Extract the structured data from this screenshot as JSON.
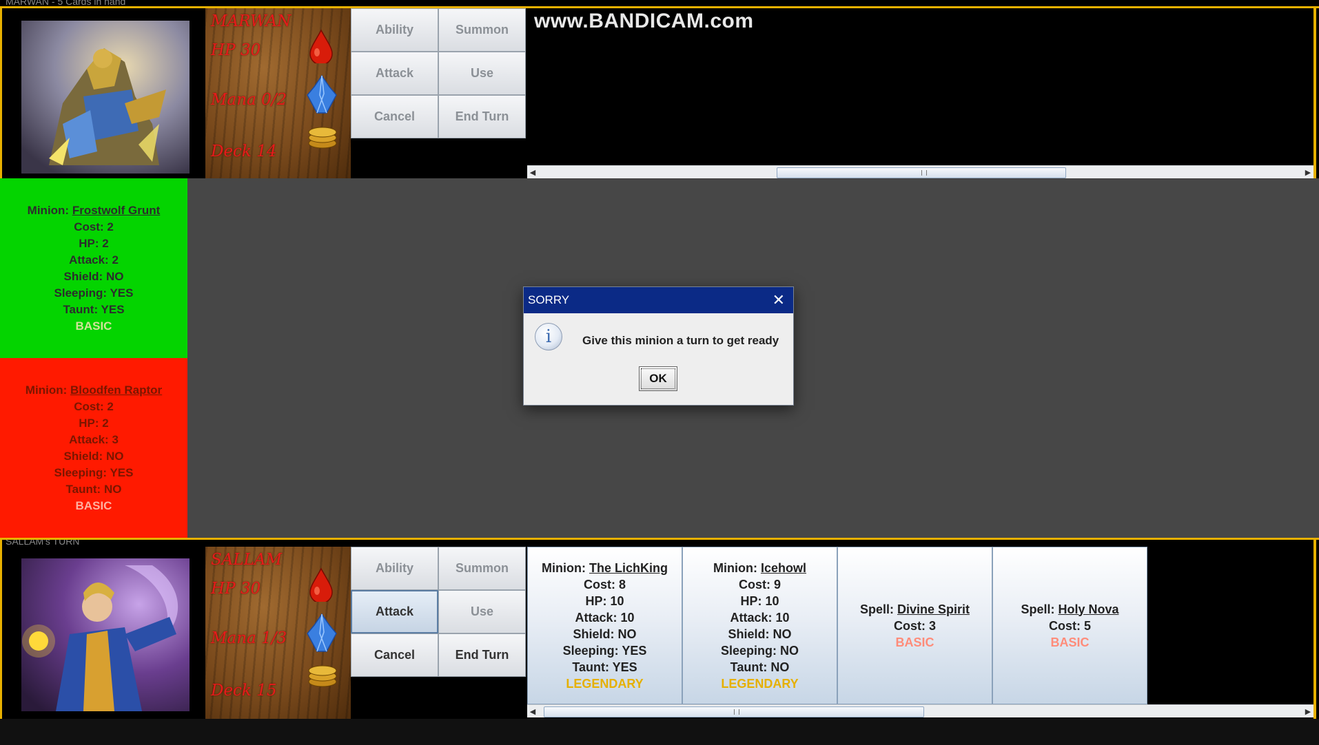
{
  "watermark": "www.BANDICAM.com",
  "top_strip": "MARWAN - 5 Cards in hand",
  "bottom_strip": "SALLAM's TURN",
  "opponent": {
    "name": "MARWAN",
    "hp": "HP 30",
    "mana": "Mana 0/2",
    "deck": "Deck 14",
    "buttons": {
      "ability": "Ability",
      "summon": "Summon",
      "attack": "Attack",
      "use": "Use",
      "cancel": "Cancel",
      "end_turn": "End Turn"
    }
  },
  "player": {
    "name": "SALLAM",
    "hp": "HP 30",
    "mana": "Mana 1/3",
    "deck": "Deck 15",
    "buttons": {
      "ability": "Ability",
      "summon": "Summon",
      "attack": "Attack",
      "use": "Use",
      "cancel": "Cancel",
      "end_turn": "End Turn"
    }
  },
  "board": [
    {
      "prefix": "Minion: ",
      "name": "Frostwolf Grunt",
      "cost": "Cost: 2",
      "hp": "HP: 2",
      "attack": "Attack: 2",
      "shield": "Shield: NO",
      "sleeping": "Sleeping: YES",
      "taunt": "Taunt: YES",
      "rarity": "BASIC",
      "color": "#04d400"
    },
    {
      "prefix": "Minion: ",
      "name": "Bloodfen Raptor",
      "cost": "Cost: 2",
      "hp": "HP: 2",
      "attack": "Attack: 3",
      "shield": "Shield: NO",
      "sleeping": "Sleeping: YES",
      "taunt": "Taunt: NO",
      "rarity": "BASIC",
      "color": "#ff1a00"
    }
  ],
  "hand": [
    {
      "prefix": "Minion: ",
      "name": "The LichKing",
      "cost": "Cost: 8",
      "hp": "HP: 10",
      "attack": "Attack: 10",
      "shield": "Shield: NO",
      "sleeping": "Sleeping: YES",
      "taunt": "Taunt: YES",
      "rarity": "LEGENDARY"
    },
    {
      "prefix": "Minion: ",
      "name": "Icehowl",
      "cost": "Cost: 9",
      "hp": "HP: 10",
      "attack": "Attack: 10",
      "shield": "Shield: NO",
      "sleeping": "Sleeping: NO",
      "taunt": "Taunt: NO",
      "rarity": "LEGENDARY"
    },
    {
      "prefix": "Spell: ",
      "name": "Divine Spirit",
      "cost": "Cost: 3",
      "rarity": "BASIC"
    },
    {
      "prefix": "Spell: ",
      "name": "Holy Nova",
      "cost": "Cost: 5",
      "rarity": "BASIC"
    }
  ],
  "dialog": {
    "title": "SORRY",
    "message": "Give this minion a turn to get ready",
    "ok": "OK",
    "icon": "info-icon"
  },
  "scroll": {
    "left": "◀",
    "right": "▶"
  }
}
